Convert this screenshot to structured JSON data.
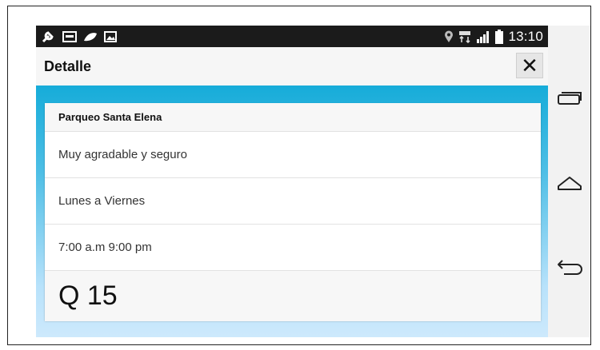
{
  "status_bar": {
    "time": "13:10",
    "left_icons": [
      "wrench-icon",
      "qslide-icon",
      "leaf-icon",
      "image-icon"
    ],
    "right_icons": [
      "location-icon",
      "data-icon",
      "signal-icon",
      "battery-icon"
    ]
  },
  "app_bar": {
    "title": "Detalle",
    "close_label": "✕"
  },
  "card": {
    "name": "Parqueo Santa Elena",
    "description": "Muy agradable y seguro",
    "days": "Lunes a Viernes",
    "hours": "7:00 a.m 9:00 pm",
    "price": "Q 15"
  },
  "nav": {
    "items": [
      "recent-apps-icon",
      "home-icon",
      "back-icon"
    ]
  },
  "colors": {
    "status_bar": "#1b1b1b",
    "accent_top": "#16acd9",
    "accent_bottom": "#cde9fc"
  }
}
